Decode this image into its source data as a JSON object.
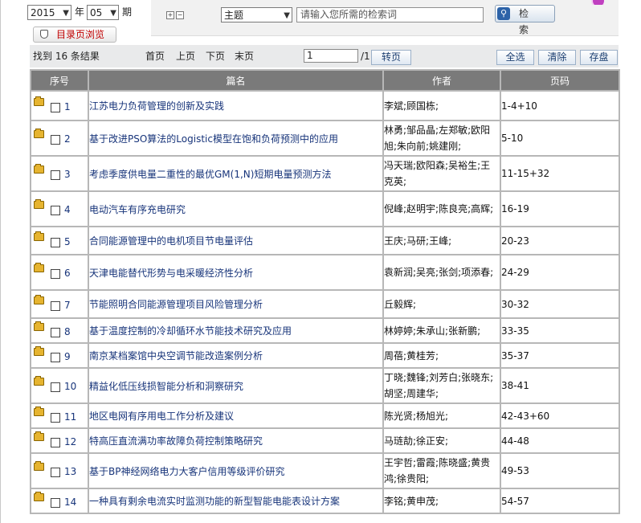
{
  "filter": {
    "year": "2015",
    "year_unit": "年",
    "month": "05",
    "month_unit": "期",
    "catalog_button": "目录页浏览",
    "field_select": "主题",
    "search_placeholder": "请输入您所需的检索词",
    "search_button": "检 索"
  },
  "toolbar": {
    "found_text": "找到 16 条结果",
    "first": "首页",
    "prev": "上页",
    "next": "下页",
    "last": "末页",
    "page_value": "1",
    "page_total": "/1",
    "go": "转页",
    "select_all": "全选",
    "clear": "清除",
    "save": "存盘"
  },
  "table": {
    "headers": [
      "序号",
      "篇名",
      "作者",
      "页码"
    ],
    "rows": [
      {
        "no": "1",
        "title": "江苏电力负荷管理的创新及实践",
        "authors": "李斌;顾国栋;",
        "pages": "1-4+10"
      },
      {
        "no": "2",
        "title": "基于改进PSO算法的Logistic模型在饱和负荷预测中的应用",
        "authors": "林勇;邹品晶;左郑敏;欧阳旭;朱向前;姚建刚;",
        "pages": "5-10"
      },
      {
        "no": "3",
        "title": "考虑季度供电量二重性的最优GM(1,N)短期电量预测方法",
        "authors": "冯天瑞;欧阳森;吴裕生;王克英;",
        "pages": "11-15+32"
      },
      {
        "no": "4",
        "title": "电动汽车有序充电研究",
        "authors": "倪峰;赵明宇;陈良亮;高辉;",
        "pages": "16-19"
      },
      {
        "no": "5",
        "title": "合同能源管理中的电机项目节电量评估",
        "authors": "王庆;马研;王峰;",
        "pages": "20-23"
      },
      {
        "no": "6",
        "title": "天津电能替代形势与电采暖经济性分析",
        "authors": "袁新润;吴亮;张剑;项添春;",
        "pages": "24-29"
      },
      {
        "no": "7",
        "title": "节能照明合同能源管理项目风险管理分析",
        "authors": "丘毅辉;",
        "pages": "30-32"
      },
      {
        "no": "8",
        "title": "基于温度控制的冷却循环水节能技术研究及应用",
        "authors": "林婷婷;朱承山;张新鹏;",
        "pages": "33-35"
      },
      {
        "no": "9",
        "title": "南京某档案馆中央空调节能改造案例分析",
        "authors": "周蓓;黄桂芳;",
        "pages": "35-37"
      },
      {
        "no": "10",
        "title": "精益化低压线损智能分析和洞察研究",
        "authors": "丁晓;魏锋;刘芳白;张晓东;胡坚;周建华;",
        "pages": "38-41"
      },
      {
        "no": "11",
        "title": "地区电网有序用电工作分析及建议",
        "authors": "陈光贤;杨旭光;",
        "pages": "42-43+60"
      },
      {
        "no": "12",
        "title": "特高压直流满功率故障负荷控制策略研究",
        "authors": "马琏劼;徐正安;",
        "pages": "44-48"
      },
      {
        "no": "13",
        "title": "基于BP神经网络电力大客户信用等级评价研究",
        "authors": "王宇哲;雷霞;陈晓盛;黄贵鸿;徐贵阳;",
        "pages": "49-53"
      },
      {
        "no": "14",
        "title": "一种具有剩余电流实时监测功能的新型智能电能表设计方案",
        "authors": "李铭;黄申茂;",
        "pages": "54-57"
      }
    ]
  }
}
